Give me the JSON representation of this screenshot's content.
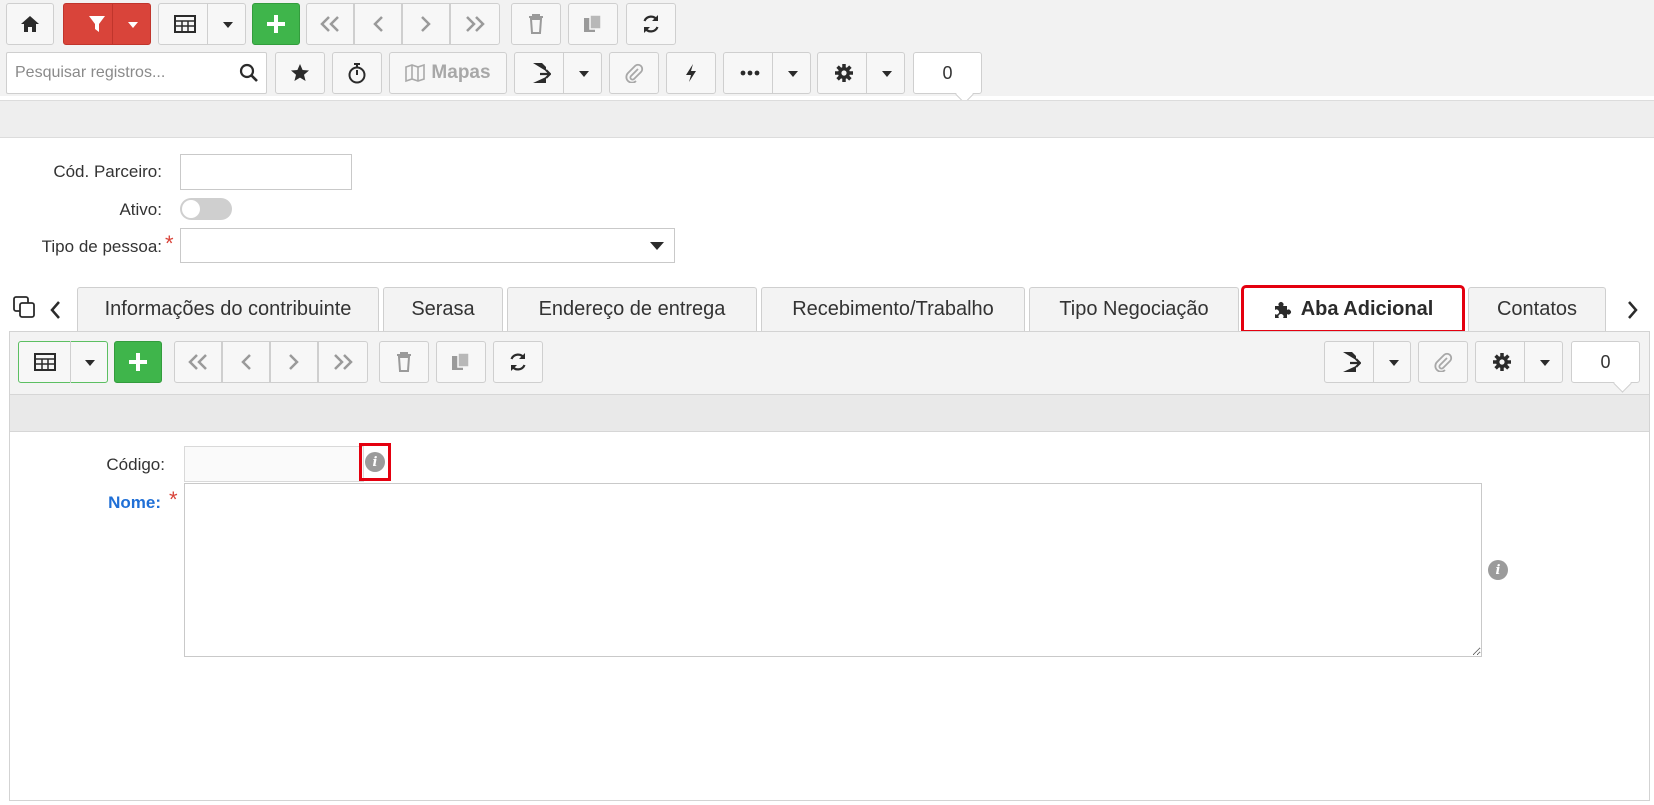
{
  "toolbar": {
    "search_placeholder": "Pesquisar registros...",
    "maps_label": "Mapas",
    "counter": "0"
  },
  "form": {
    "cod_parceiro_label": "Cód. Parceiro:",
    "ativo_label": "Ativo:",
    "tipo_pessoa_label": "Tipo de pessoa:",
    "required_mark": "*"
  },
  "tabs": [
    {
      "label": "Informações do contribuinte"
    },
    {
      "label": "Serasa"
    },
    {
      "label": "Endereço de entrega"
    },
    {
      "label": "Recebimento/Trabalho"
    },
    {
      "label": "Tipo Negociação"
    },
    {
      "label": "Aba Adicional",
      "active": true
    },
    {
      "label": "Contatos"
    }
  ],
  "subpanel": {
    "counter": "0",
    "codigo_label": "Código:",
    "nome_label": "Nome:",
    "required_mark": "*",
    "info_glyph": "i"
  },
  "colors": {
    "filter_red": "#d9443a",
    "add_green": "#3fb54b",
    "highlight": "#e4000f",
    "nome_blue": "#1f6fd6"
  },
  "icons": [
    "home-icon",
    "filter-icon",
    "grid-icon",
    "plus-icon",
    "first-icon",
    "prev-icon",
    "next-icon",
    "last-icon",
    "trash-icon",
    "copy-icon",
    "refresh-icon",
    "search-icon",
    "star-icon",
    "stopwatch-icon",
    "map-icon",
    "export-icon",
    "paperclip-icon",
    "bolt-icon",
    "more-icon",
    "gear-icon",
    "puzzle-icon",
    "info-icon"
  ]
}
